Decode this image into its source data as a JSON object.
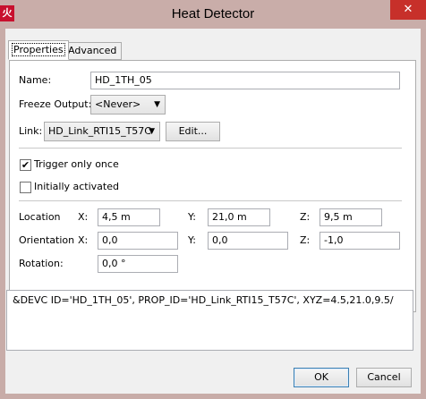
{
  "window": {
    "title": "Heat Detector",
    "app_icon_glyph": "火",
    "close_glyph": "✕"
  },
  "tabs": [
    {
      "label": "Properties",
      "active": true
    },
    {
      "label": "Advanced",
      "active": false
    }
  ],
  "fields": {
    "name_label": "Name:",
    "name_value": "HD_1TH_05",
    "freeze_label": "Freeze Output:",
    "freeze_value": "<Never>",
    "link_label": "Link:",
    "link_value": "HD_Link_RTI15_T57C",
    "edit_button": "Edit...",
    "trigger_label": "Trigger only once",
    "trigger_checked": true,
    "initially_label": "Initially activated",
    "initially_checked": false
  },
  "location": {
    "label": "Location",
    "x_label": "X:",
    "x": "4,5 m",
    "y_label": "Y:",
    "y": "21,0 m",
    "z_label": "Z:",
    "z": "9,5 m"
  },
  "orientation": {
    "label": "Orientation",
    "x_label": "X:",
    "x": "0,0",
    "y_label": "Y:",
    "y": "0,0",
    "z_label": "Z:",
    "z": "-1,0"
  },
  "rotation": {
    "label": "Rotation:",
    "value": "0,0 °"
  },
  "output_text": "&DEVC ID='HD_1TH_05', PROP_ID='HD_Link_RTI15_T57C', XYZ=4.5,21.0,9.5/",
  "buttons": {
    "ok": "OK",
    "cancel": "Cancel"
  },
  "colors": {
    "titlebar": "#c9ada9",
    "close": "#c7302a",
    "app_icon": "#c8102e"
  }
}
